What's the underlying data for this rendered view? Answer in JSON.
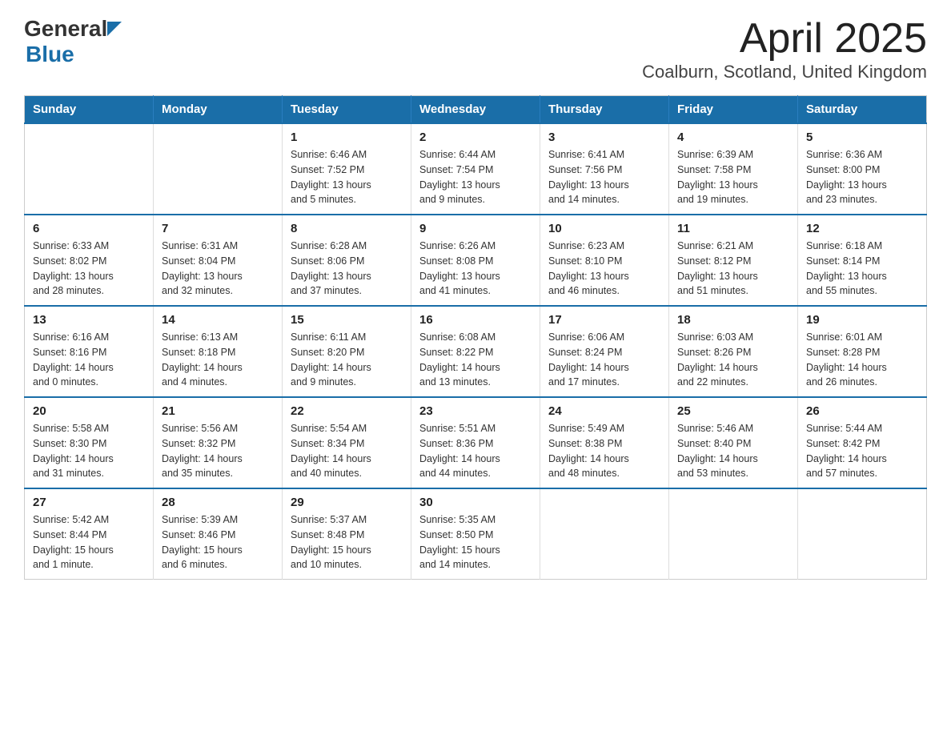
{
  "header": {
    "logo_general": "General",
    "logo_blue": "Blue",
    "month_title": "April 2025",
    "location": "Coalburn, Scotland, United Kingdom"
  },
  "days_of_week": [
    "Sunday",
    "Monday",
    "Tuesday",
    "Wednesday",
    "Thursday",
    "Friday",
    "Saturday"
  ],
  "weeks": [
    [
      {
        "num": "",
        "info": ""
      },
      {
        "num": "",
        "info": ""
      },
      {
        "num": "1",
        "info": "Sunrise: 6:46 AM\nSunset: 7:52 PM\nDaylight: 13 hours\nand 5 minutes."
      },
      {
        "num": "2",
        "info": "Sunrise: 6:44 AM\nSunset: 7:54 PM\nDaylight: 13 hours\nand 9 minutes."
      },
      {
        "num": "3",
        "info": "Sunrise: 6:41 AM\nSunset: 7:56 PM\nDaylight: 13 hours\nand 14 minutes."
      },
      {
        "num": "4",
        "info": "Sunrise: 6:39 AM\nSunset: 7:58 PM\nDaylight: 13 hours\nand 19 minutes."
      },
      {
        "num": "5",
        "info": "Sunrise: 6:36 AM\nSunset: 8:00 PM\nDaylight: 13 hours\nand 23 minutes."
      }
    ],
    [
      {
        "num": "6",
        "info": "Sunrise: 6:33 AM\nSunset: 8:02 PM\nDaylight: 13 hours\nand 28 minutes."
      },
      {
        "num": "7",
        "info": "Sunrise: 6:31 AM\nSunset: 8:04 PM\nDaylight: 13 hours\nand 32 minutes."
      },
      {
        "num": "8",
        "info": "Sunrise: 6:28 AM\nSunset: 8:06 PM\nDaylight: 13 hours\nand 37 minutes."
      },
      {
        "num": "9",
        "info": "Sunrise: 6:26 AM\nSunset: 8:08 PM\nDaylight: 13 hours\nand 41 minutes."
      },
      {
        "num": "10",
        "info": "Sunrise: 6:23 AM\nSunset: 8:10 PM\nDaylight: 13 hours\nand 46 minutes."
      },
      {
        "num": "11",
        "info": "Sunrise: 6:21 AM\nSunset: 8:12 PM\nDaylight: 13 hours\nand 51 minutes."
      },
      {
        "num": "12",
        "info": "Sunrise: 6:18 AM\nSunset: 8:14 PM\nDaylight: 13 hours\nand 55 minutes."
      }
    ],
    [
      {
        "num": "13",
        "info": "Sunrise: 6:16 AM\nSunset: 8:16 PM\nDaylight: 14 hours\nand 0 minutes."
      },
      {
        "num": "14",
        "info": "Sunrise: 6:13 AM\nSunset: 8:18 PM\nDaylight: 14 hours\nand 4 minutes."
      },
      {
        "num": "15",
        "info": "Sunrise: 6:11 AM\nSunset: 8:20 PM\nDaylight: 14 hours\nand 9 minutes."
      },
      {
        "num": "16",
        "info": "Sunrise: 6:08 AM\nSunset: 8:22 PM\nDaylight: 14 hours\nand 13 minutes."
      },
      {
        "num": "17",
        "info": "Sunrise: 6:06 AM\nSunset: 8:24 PM\nDaylight: 14 hours\nand 17 minutes."
      },
      {
        "num": "18",
        "info": "Sunrise: 6:03 AM\nSunset: 8:26 PM\nDaylight: 14 hours\nand 22 minutes."
      },
      {
        "num": "19",
        "info": "Sunrise: 6:01 AM\nSunset: 8:28 PM\nDaylight: 14 hours\nand 26 minutes."
      }
    ],
    [
      {
        "num": "20",
        "info": "Sunrise: 5:58 AM\nSunset: 8:30 PM\nDaylight: 14 hours\nand 31 minutes."
      },
      {
        "num": "21",
        "info": "Sunrise: 5:56 AM\nSunset: 8:32 PM\nDaylight: 14 hours\nand 35 minutes."
      },
      {
        "num": "22",
        "info": "Sunrise: 5:54 AM\nSunset: 8:34 PM\nDaylight: 14 hours\nand 40 minutes."
      },
      {
        "num": "23",
        "info": "Sunrise: 5:51 AM\nSunset: 8:36 PM\nDaylight: 14 hours\nand 44 minutes."
      },
      {
        "num": "24",
        "info": "Sunrise: 5:49 AM\nSunset: 8:38 PM\nDaylight: 14 hours\nand 48 minutes."
      },
      {
        "num": "25",
        "info": "Sunrise: 5:46 AM\nSunset: 8:40 PM\nDaylight: 14 hours\nand 53 minutes."
      },
      {
        "num": "26",
        "info": "Sunrise: 5:44 AM\nSunset: 8:42 PM\nDaylight: 14 hours\nand 57 minutes."
      }
    ],
    [
      {
        "num": "27",
        "info": "Sunrise: 5:42 AM\nSunset: 8:44 PM\nDaylight: 15 hours\nand 1 minute."
      },
      {
        "num": "28",
        "info": "Sunrise: 5:39 AM\nSunset: 8:46 PM\nDaylight: 15 hours\nand 6 minutes."
      },
      {
        "num": "29",
        "info": "Sunrise: 5:37 AM\nSunset: 8:48 PM\nDaylight: 15 hours\nand 10 minutes."
      },
      {
        "num": "30",
        "info": "Sunrise: 5:35 AM\nSunset: 8:50 PM\nDaylight: 15 hours\nand 14 minutes."
      },
      {
        "num": "",
        "info": ""
      },
      {
        "num": "",
        "info": ""
      },
      {
        "num": "",
        "info": ""
      }
    ]
  ]
}
